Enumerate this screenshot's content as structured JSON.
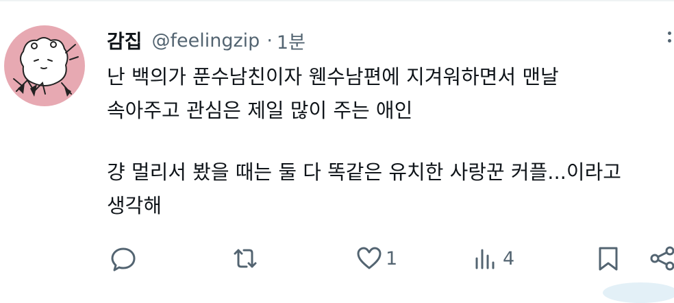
{
  "user": {
    "display_name": "감집",
    "handle": "@feelingzip",
    "separator": "·",
    "time": "1분",
    "avatar_icon": "cartoon-avatar-icon",
    "avatar_bg": "#e7a9b2"
  },
  "tweet": {
    "lines": [
      "난 백의가 푼수남친이자 웬수남편에 지겨워하면서 맨날",
      "속아주고 관심은 제일 많이 주는 애인",
      "",
      "걍 멀리서 봤을 때는 둘 다 똑같은 유치한 사랑꾼 커플...이라고",
      "생각해"
    ]
  },
  "actions": {
    "reply": {
      "icon": "reply-icon",
      "count": ""
    },
    "retweet": {
      "icon": "retweet-icon",
      "count": ""
    },
    "like": {
      "icon": "heart-icon",
      "count": "1"
    },
    "views": {
      "icon": "analytics-icon",
      "count": "4"
    },
    "bookmark": {
      "icon": "bookmark-icon"
    },
    "share": {
      "icon": "share-icon"
    }
  },
  "colors": {
    "text": "#0f1419",
    "secondary": "#536471"
  }
}
